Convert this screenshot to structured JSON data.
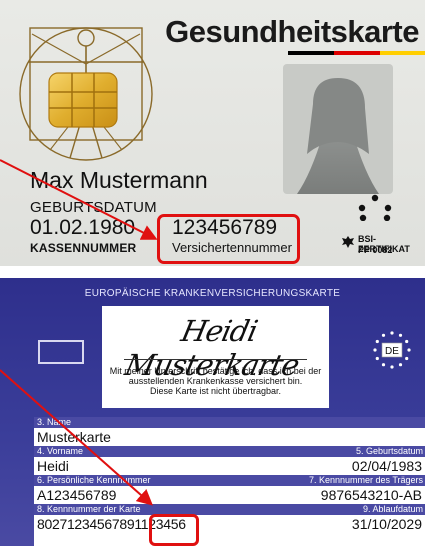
{
  "front": {
    "title": "Gesundheitskarte",
    "holder_name": "Max Mustermann",
    "dob_label": "GEBURTSDATUM",
    "dob_value": "01.02.1980",
    "kasse_label": "KASSENNUMMER",
    "insurance_no_value": "123456789",
    "insurance_no_label": "Versichertennummer",
    "bsi_line1": "BSI-ZERTIFIKAT",
    "bsi_line2": "PP 0082",
    "flag_colors": [
      "#000000",
      "#dd0000",
      "#ffce00"
    ],
    "highlight_color": "#e01010"
  },
  "back": {
    "title": "EUROPÄISCHE KRANKENVERSICHERUNGSKARTE",
    "signature": "Heidi Musterkarte",
    "signature_note_line1": "Mit meiner Unterschrift bestätige ich, dass ich bei der",
    "signature_note_line2": "ausstellenden Krankenkasse versichert bin.",
    "signature_note_line3": "Diese Karte ist nicht übertragbar.",
    "eu_code": "DE",
    "fields": {
      "name_label": "3. Name",
      "name_value": "Musterkarte",
      "firstname_label": "4. Vorname",
      "firstname_value": "Heidi",
      "dob_label": "5. Geburtsdatum",
      "dob_value": "02/04/1983",
      "personal_id_label": "6. Persönliche Kennnummer",
      "personal_id_value": "A123456789",
      "institution_label": "7. Kennnummer des Trägers",
      "institution_value": "9876543210-AB",
      "cardno_label": "8. Kennnummer der Karte",
      "cardno_value_prefix": "80271234567891",
      "cardno_value_highlight": "123456",
      "expiry_label": "9. Ablaufdatum",
      "expiry_value": "31/10/2029"
    },
    "card_color": "#33358f"
  }
}
